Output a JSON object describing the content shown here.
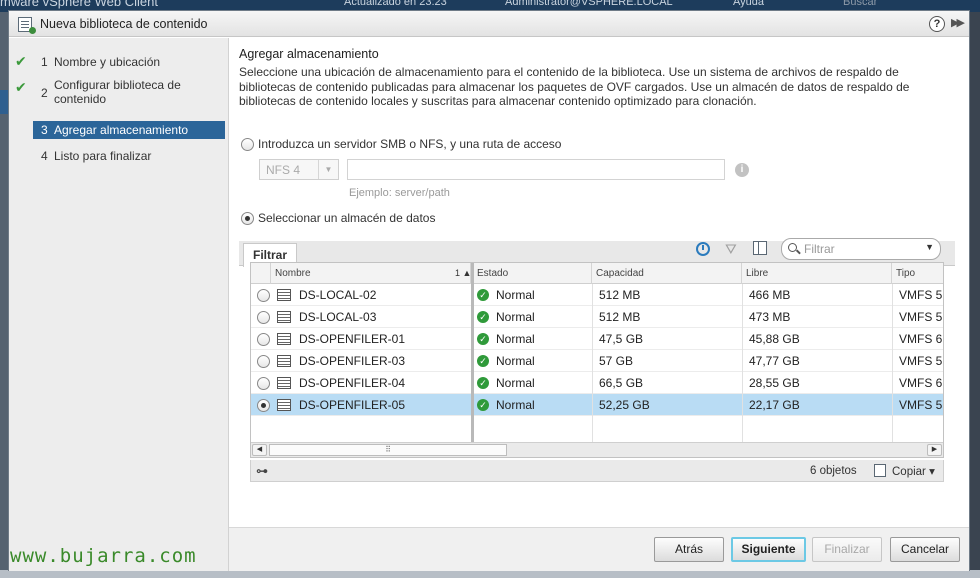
{
  "background": {
    "brand": "mware vSphere Web Client",
    "updated": "Actualizado en 23:23",
    "user": "Administrator@VSPHERE.LOCAL",
    "help": "Ayuda",
    "search": "Buscar"
  },
  "dialog": {
    "title": "Nueva biblioteca de contenido",
    "help_label": "?",
    "expand_label": "▶▶"
  },
  "steps": [
    {
      "num": "1",
      "label": "Nombre y ubicación",
      "state": "done"
    },
    {
      "num": "2",
      "label": "Configurar biblioteca de contenido",
      "state": "done"
    },
    {
      "num": "3",
      "label": "Agregar almacenamiento",
      "state": "active"
    },
    {
      "num": "4",
      "label": "Listo para finalizar",
      "state": "pending"
    }
  ],
  "section": {
    "title": "Agregar almacenamiento",
    "description": "Seleccione una ubicación de almacenamiento para el contenido de la biblioteca. Use un sistema de archivos de respaldo de bibliotecas de contenido publicadas para almacenar los paquetes de OVF cargados. Use un almacén de datos de respaldo de bibliotecas de contenido locales y suscritas para almacenar contenido optimizado para clonación."
  },
  "options": {
    "smb_nfs_label": "Introduzca un servidor SMB o NFS, y una ruta de acceso",
    "nfs_version": "NFS 4",
    "server_example": "Ejemplo: server/path",
    "datastore_label": "Seleccionar un almacén de datos"
  },
  "tabs": [
    {
      "label": "Filtrar"
    }
  ],
  "filter": {
    "placeholder": "Filtrar"
  },
  "grid": {
    "columns": [
      "Nombre",
      "Estado",
      "Capacidad",
      "Libre",
      "Tipo"
    ],
    "sort_indicator": "1 ▲",
    "rows": [
      {
        "name": "DS-LOCAL-02",
        "status": "Normal",
        "capacity": "512  MB",
        "free": "466  MB",
        "type": "VMFS 5",
        "selected": false
      },
      {
        "name": "DS-LOCAL-03",
        "status": "Normal",
        "capacity": "512  MB",
        "free": "473  MB",
        "type": "VMFS 5",
        "selected": false
      },
      {
        "name": "DS-OPENFILER-01",
        "status": "Normal",
        "capacity": "47,5  GB",
        "free": "45,88  GB",
        "type": "VMFS 6",
        "selected": false
      },
      {
        "name": "DS-OPENFILER-03",
        "status": "Normal",
        "capacity": "57  GB",
        "free": "47,77  GB",
        "type": "VMFS 5",
        "selected": false
      },
      {
        "name": "DS-OPENFILER-04",
        "status": "Normal",
        "capacity": "66,5  GB",
        "free": "28,55  GB",
        "type": "VMFS 6",
        "selected": false
      },
      {
        "name": "DS-OPENFILER-05",
        "status": "Normal",
        "capacity": "52,25  GB",
        "free": "22,17  GB",
        "type": "VMFS 5",
        "selected": true
      }
    ],
    "count": "6 objetos",
    "copy_label": "Copiar"
  },
  "buttons": {
    "back": "Atrás",
    "next": "Siguiente",
    "finish": "Finalizar",
    "cancel": "Cancelar"
  },
  "watermark": "www.bujarra.com",
  "colors": {
    "active_step": "#2b6599",
    "selected_row": "#b9dcf4",
    "ok_status": "#2f9a3a",
    "primary_border": "#6cc9e5"
  }
}
